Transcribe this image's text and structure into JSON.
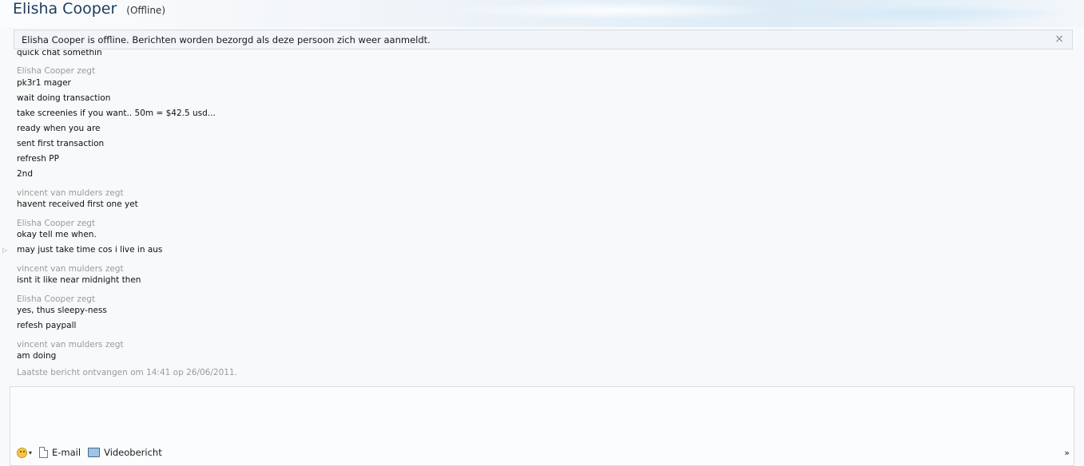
{
  "header": {
    "contact_name": "Elisha Cooper",
    "status": "(Offline)"
  },
  "notice": {
    "text": "Elisha Cooper is offline. Berichten worden bezorgd als deze persoon zich weer aanmeldt.",
    "close_glyph": "×"
  },
  "conversation": {
    "partial_line": "quick chat somethin",
    "blocks": [
      {
        "sender": "Elisha Cooper zegt",
        "lines": [
          "pk3r1 mager",
          "wait doing transaction",
          "take screenies if you want.. 50m = $42.5 usd...",
          "ready when you are",
          "sent first transaction",
          "refresh PP",
          "2nd"
        ]
      },
      {
        "sender": "vincent van mulders zegt",
        "lines": [
          "havent received first one yet"
        ]
      },
      {
        "sender": "Elisha Cooper zegt",
        "lines": [
          "okay tell me when.",
          "may just take time cos i live in aus"
        ]
      },
      {
        "sender": "vincent van mulders zegt",
        "lines": [
          "isnt it like near midnight then"
        ]
      },
      {
        "sender": "Elisha Cooper zegt",
        "lines": [
          "yes, thus sleepy-ness",
          "refesh paypall"
        ]
      },
      {
        "sender": "vincent van mulders zegt",
        "lines": [
          "am doing"
        ]
      }
    ],
    "last_received": "Laatste bericht ontvangen om 14:41 op 26/06/2011.",
    "marker_glyph": "▷"
  },
  "toolbar": {
    "emoticon_icon": "emoticon-icon",
    "caret": "▾",
    "email_label": "E-mail",
    "video_label": "Videobericht",
    "more_glyph": "»"
  }
}
